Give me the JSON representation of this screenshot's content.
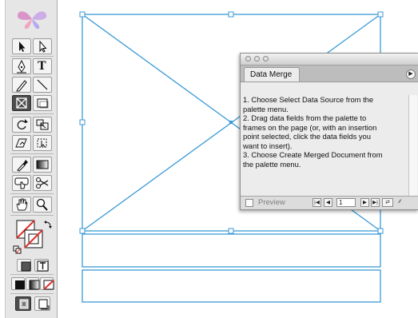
{
  "palette": {
    "title": "Data Merge",
    "menu_icon": "palette-menu-triangle",
    "instructions": [
      "1. Choose Select Data Source from the",
      "palette menu.",
      "2. Drag data fields from the palette to",
      "frames on the page (or, with an insertion",
      "point selected, click the data fields you",
      "want to insert).",
      "3. Choose Create Merged Document from",
      "the palette menu."
    ],
    "preview_label": "Preview",
    "record_number": "1",
    "nav_icons": [
      "first-record-icon",
      "previous-record-icon",
      "next-record-icon",
      "last-record-icon",
      "create-merged-document-icon",
      "resize-grip-icon"
    ]
  },
  "toolbox": {
    "type_tool_label": "T",
    "tools": [
      "selection-tool",
      "direct-selection-tool",
      "pen-tool",
      "type-tool",
      "pencil-tool",
      "line-tool",
      "rectangle-frame-tool",
      "rectangle-tool",
      "rotate-tool",
      "scale-tool",
      "shear-tool",
      "free-transform-tool",
      "eyedropper-tool",
      "gradient-tool",
      "button-tool",
      "scissors-tool",
      "hand-tool",
      "zoom-tool",
      "fill-stroke-swatch",
      "apply-color",
      "apply-gradient",
      "apply-none",
      "normal-view",
      "preview-view"
    ]
  },
  "colors": {
    "frame_stroke": "#3a9ad6",
    "none_red": "#e0302b",
    "toolbox_bg": "#e6e6e6"
  }
}
